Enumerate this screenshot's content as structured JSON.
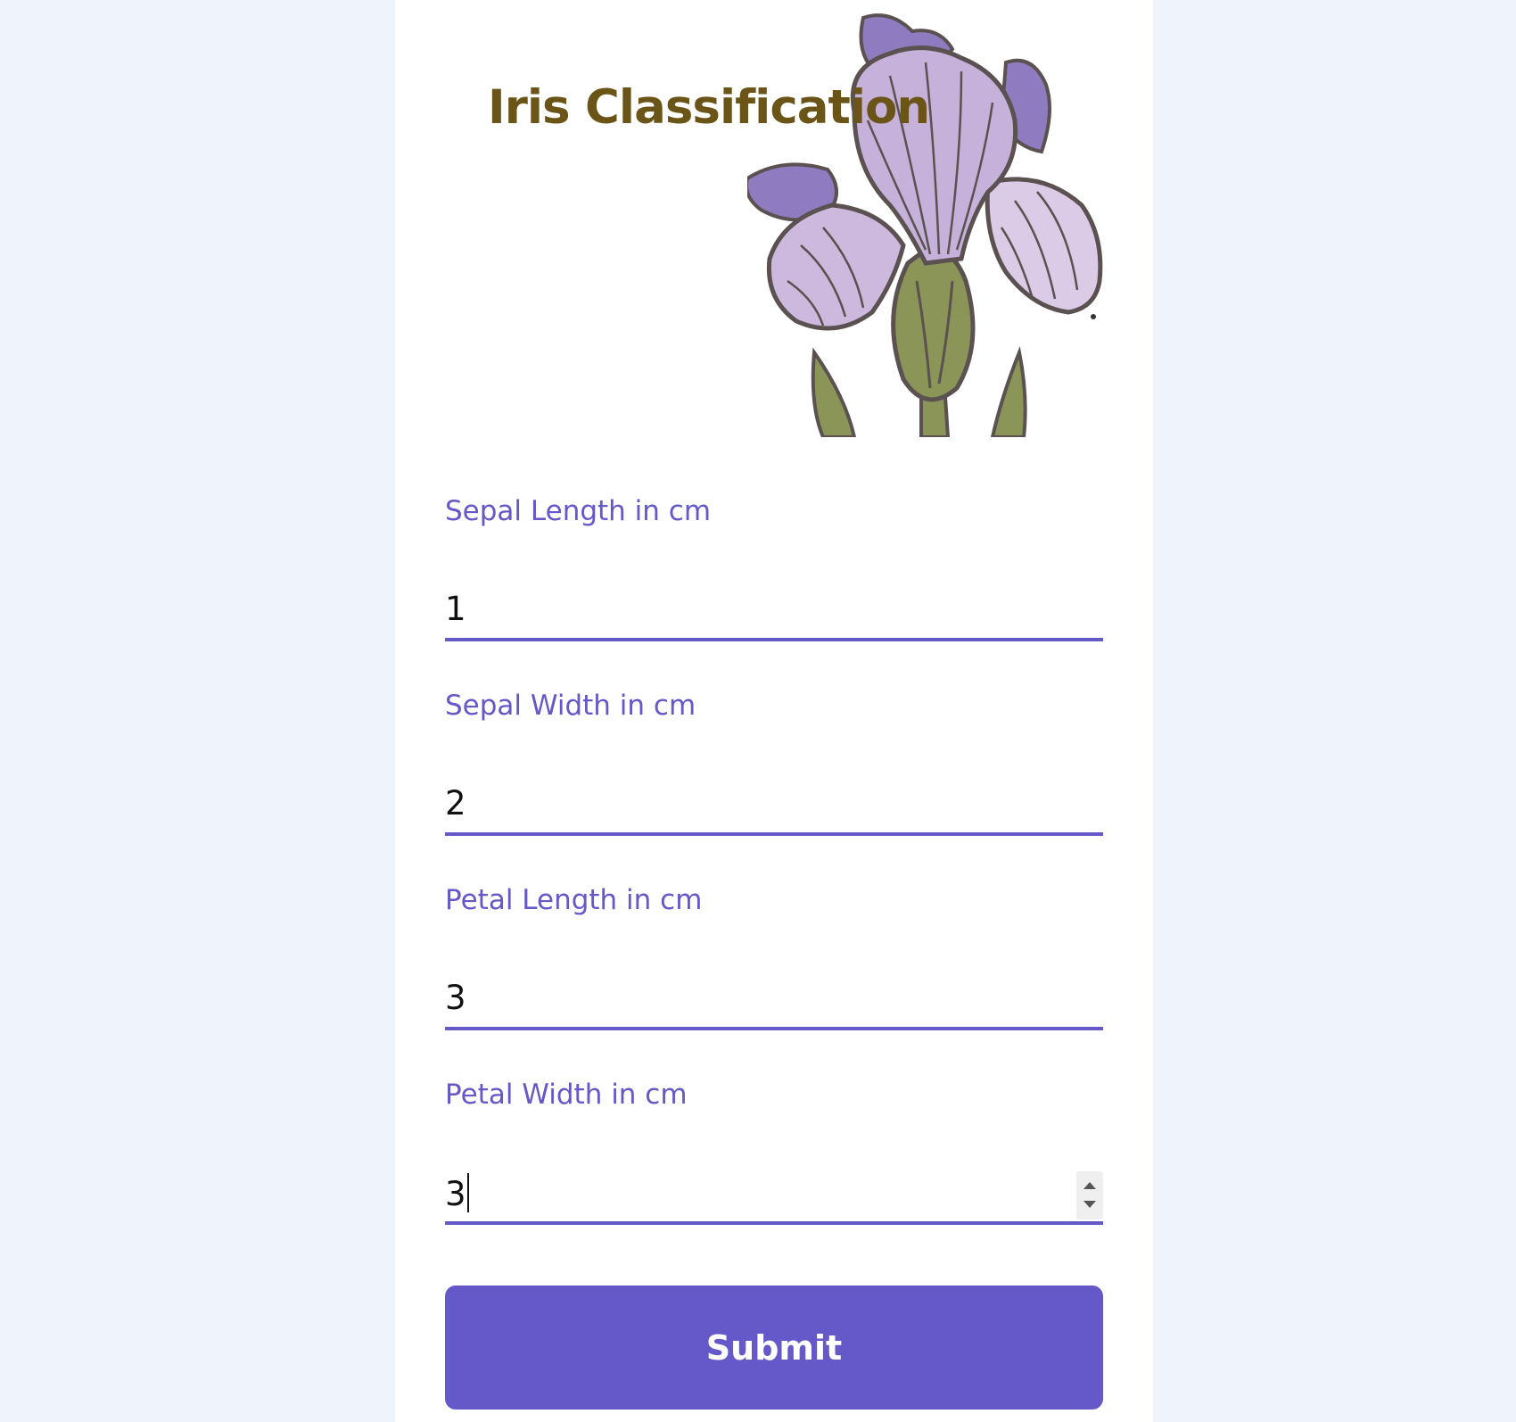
{
  "header": {
    "title": "Iris Classification"
  },
  "form": {
    "fields": [
      {
        "label": "Sepal Length in cm",
        "value": "1"
      },
      {
        "label": "Sepal Width in cm",
        "value": "2"
      },
      {
        "label": "Petal Length in cm",
        "value": "3"
      },
      {
        "label": "Petal Width in cm",
        "value": "3"
      }
    ],
    "submit_label": "Submit"
  },
  "colors": {
    "accent": "#6558c8",
    "title": "#6b5417",
    "background": "#eff3fb",
    "card": "#ffffff"
  },
  "icons": {
    "hero": "iris-flower-illustration",
    "spinner": "number-spinner-icon"
  }
}
